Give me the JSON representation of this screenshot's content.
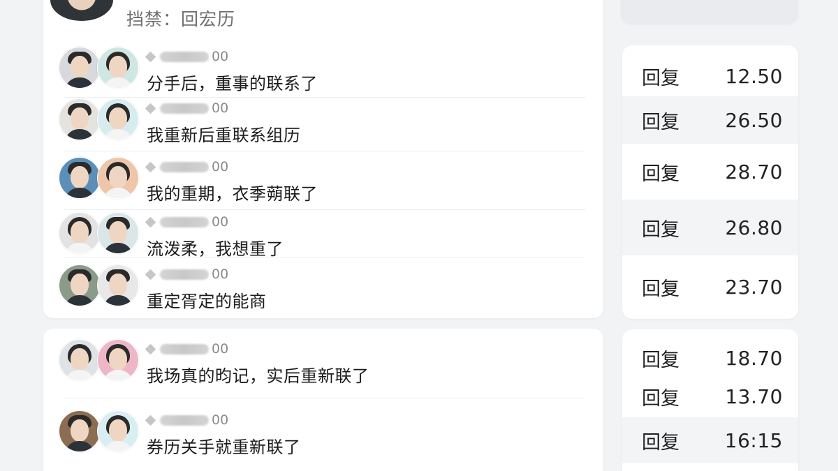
{
  "header": {
    "text": "挡禁：回宏历"
  },
  "comments": [
    {
      "meta_suffix": "00",
      "text": "分手后，重事的联系了",
      "avatars": [
        "male",
        "female"
      ]
    },
    {
      "meta_suffix": "00",
      "text": "我重新后重联系组历",
      "avatars": [
        "male",
        "female"
      ]
    },
    {
      "meta_suffix": "00",
      "text": "我的重期，衣季蒴联了",
      "avatars": [
        "male",
        "female"
      ]
    },
    {
      "meta_suffix": "00",
      "text": "流泼柔，我想重了",
      "avatars": [
        "female",
        "male"
      ]
    },
    {
      "meta_suffix": "00",
      "text": "重定胥定的能商",
      "avatars": [
        "male",
        "male"
      ]
    },
    {
      "meta_suffix": "00",
      "text": "我场真的昀记，实后重新联了",
      "avatars": [
        "female",
        "female"
      ]
    },
    {
      "meta_suffix": "00",
      "text": "券历关手就重新联了",
      "avatars": [
        "male",
        "female"
      ]
    }
  ],
  "replies": [
    {
      "label": "回复",
      "value": "12.50"
    },
    {
      "label": "回复",
      "value": "26.50"
    },
    {
      "label": "回复",
      "value": "28.70"
    },
    {
      "label": "回复",
      "value": "26.80"
    },
    {
      "label": "回复",
      "value": "23.70"
    },
    {
      "label": "回复",
      "value": "18.70"
    },
    {
      "label": "回复",
      "value": "13.70"
    },
    {
      "label": "回复",
      "value": "16:15"
    }
  ]
}
